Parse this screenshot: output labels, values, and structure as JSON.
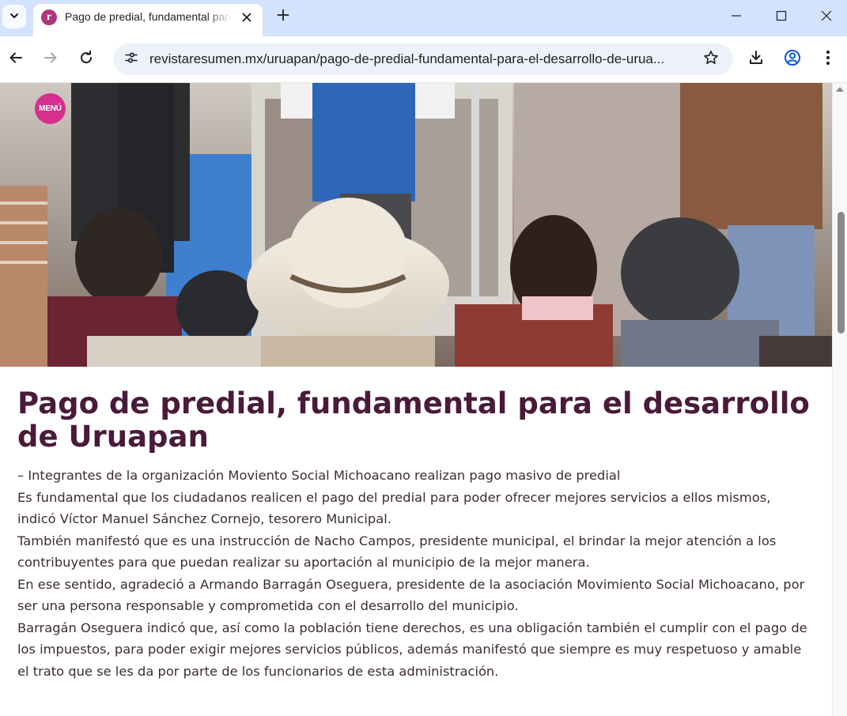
{
  "browser": {
    "tab_title": "Pago de predial, fundamental para el desarrollo de Uruapan",
    "tab_favicon_letter": "r",
    "url": "revistaresumen.mx/uruapan/pago-de-predial-fundamental-para-el-desarrollo-de-urua..."
  },
  "page": {
    "menu_label": "MENÚ",
    "headline": "Pago de predial, fundamental para el desarrollo de Uruapan",
    "paragraphs": [
      "– Integrantes de la organización Moviento Social Michoacano realizan pago masivo de predial",
      "Es fundamental que los ciudadanos realicen el pago del predial para poder ofrecer mejores servicios a ellos mismos, indicó Víctor Manuel Sánchez Cornejo, tesorero Municipal.",
      "También manifestó que es una instrucción de Nacho Campos, presidente municipal, el brindar la mejor atención a los contribuyentes para que puedan realizar su aportación al municipio de la mejor manera.",
      "En ese sentido, agradeció a Armando Barragán Oseguera, presidente de la asociación Movimiento Social Michoacano, por ser una persona responsable y comprometida con el desarrollo del municipio.",
      "Barragán Oseguera indicó que, así como la población tiene derechos, es una obligación también el cumplir con el pago de los impuestos, para poder exigir mejores servicios públicos, además manifestó que siempre es muy respetuoso y amable el trato que se les da por parte de los funcionarios de esta administración."
    ]
  },
  "colors": {
    "tabbar_bg": "#d3e3fd",
    "headline": "#4a1a3a",
    "menu_badge": "#d62f8e"
  }
}
